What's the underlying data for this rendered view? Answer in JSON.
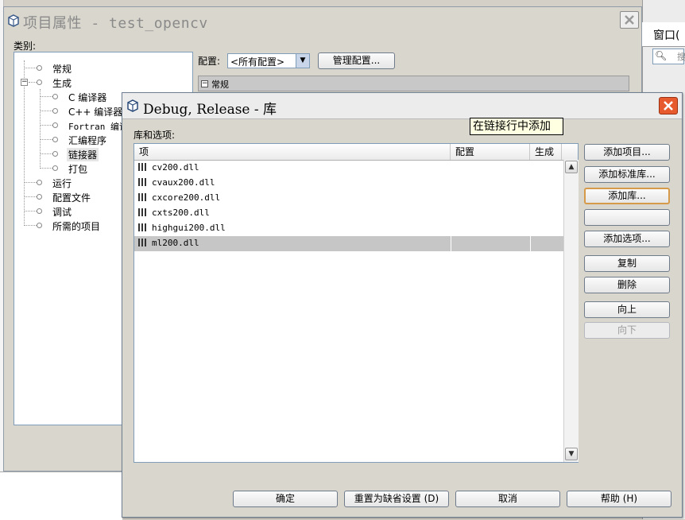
{
  "background": {
    "window_label": "窗口(",
    "search_placeholder": "搜"
  },
  "project_properties": {
    "title_prefix": "项目属性",
    "title_sep": " - ",
    "title_project": "test_opencv",
    "category_label": "类别:",
    "tree": [
      {
        "label": "常规",
        "level": 0
      },
      {
        "label": "生成",
        "level": 0,
        "expanded": true
      },
      {
        "label": "C 编译器",
        "level": 1
      },
      {
        "label": "C++ 编译器",
        "level": 1
      },
      {
        "label": "Fortran 编译",
        "level": 1
      },
      {
        "label": "汇编程序",
        "level": 1
      },
      {
        "label": "链接器",
        "level": 1,
        "selected": true
      },
      {
        "label": "打包",
        "level": 1
      },
      {
        "label": "运行",
        "level": 0
      },
      {
        "label": "配置文件",
        "level": 0
      },
      {
        "label": "调试",
        "level": 0
      },
      {
        "label": "所需的项目",
        "level": 0
      }
    ],
    "config_label": "配置:",
    "config_value": "<所有配置>",
    "manage_config_button": "管理配置...",
    "section_header": "常规"
  },
  "library_dialog": {
    "title": "Debug, Release - 库",
    "list_label": "库和选项:",
    "columns": [
      "项",
      "配置",
      "生成"
    ],
    "rows": [
      {
        "name": "cv200.dll",
        "selected": false
      },
      {
        "name": "cvaux200.dll",
        "selected": false
      },
      {
        "name": "cxcore200.dll",
        "selected": false
      },
      {
        "name": "cxts200.dll",
        "selected": false
      },
      {
        "name": "highgui200.dll",
        "selected": false
      },
      {
        "name": "ml200.dll",
        "selected": true
      }
    ],
    "buttons": {
      "add_project": "添加项目...",
      "add_standard_library": "添加标准库...",
      "add_library": "添加库...",
      "add_library_file": "",
      "add_option": "添加选项...",
      "copy": "复制",
      "delete": "删除",
      "move_up": "向上",
      "move_down": "向下"
    },
    "tooltip": "在链接行中添加",
    "footer": {
      "ok": "确定",
      "reset": "重置为缺省设置 (D)",
      "cancel": "取消",
      "help": "帮助 (H)"
    }
  }
}
